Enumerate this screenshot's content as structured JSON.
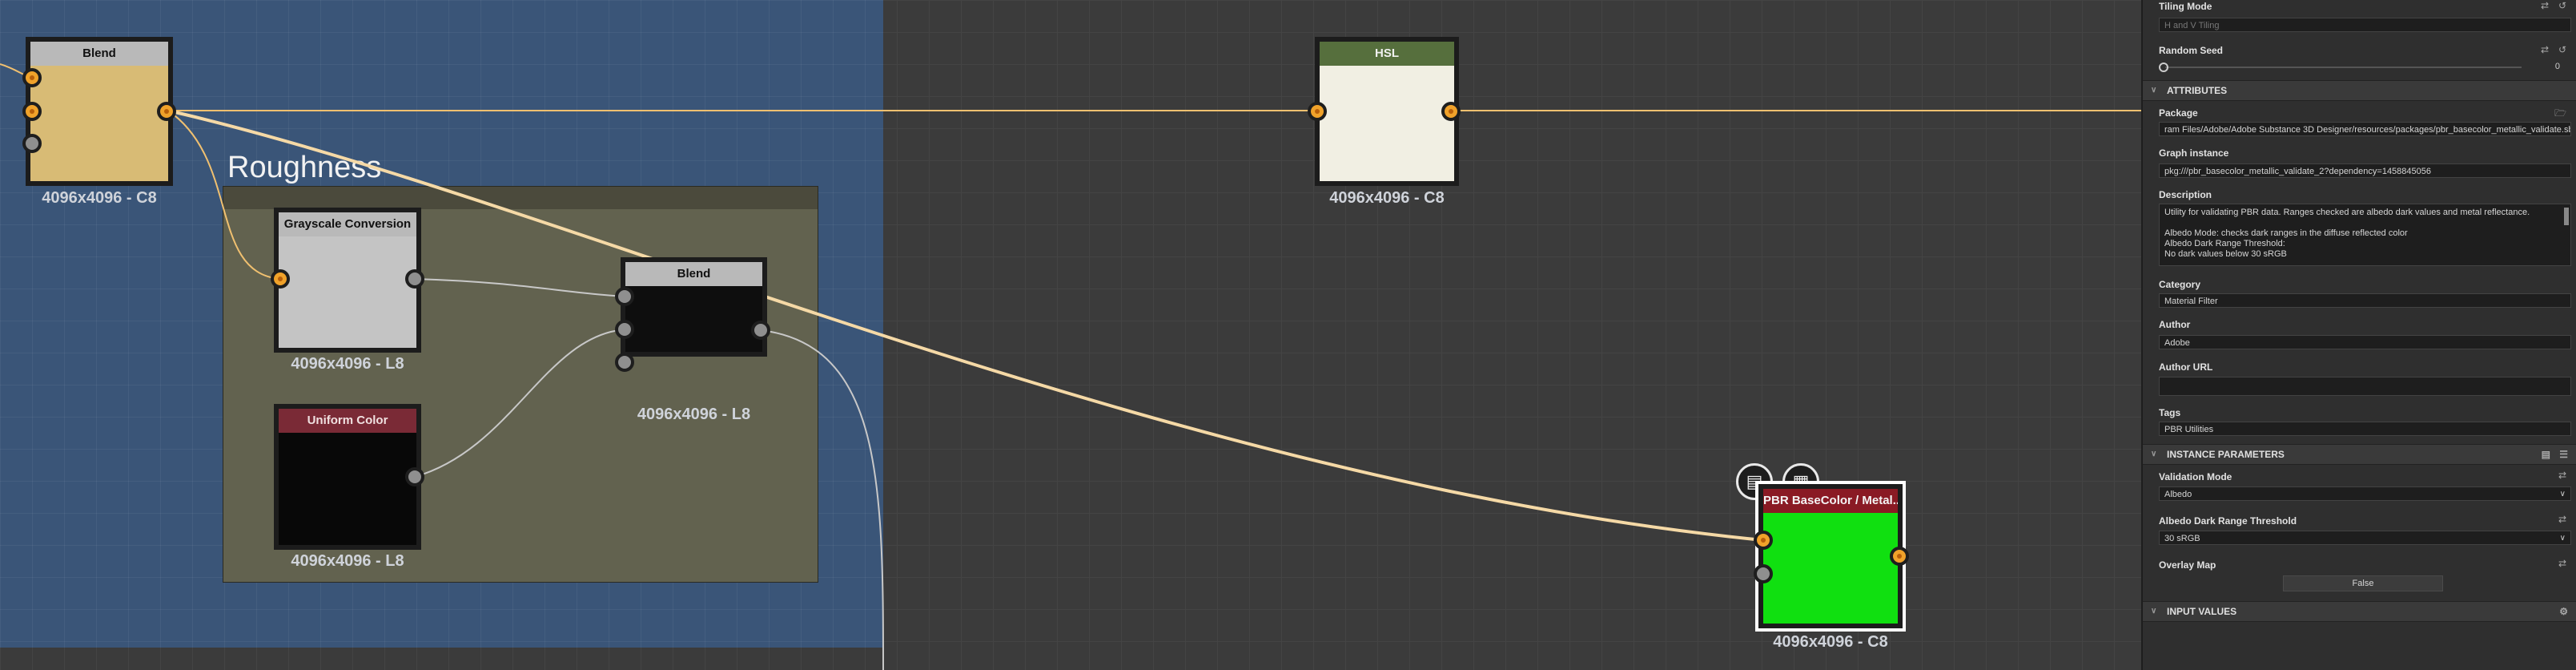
{
  "graph": {
    "frame_title": "Roughness",
    "nodes": {
      "blend_top": {
        "title": "Blend",
        "res": "4096x4096 - C8"
      },
      "grayscale": {
        "title": "Grayscale Conversion",
        "res": "4096x4096 - L8"
      },
      "blend_inner": {
        "title": "Blend",
        "res": "4096x4096 - L8"
      },
      "uniform_color": {
        "title": "Uniform Color",
        "res": "4096x4096 - L8"
      },
      "hsl": {
        "title": "HSL",
        "res": "4096x4096 - C8"
      },
      "pbr": {
        "title": "PBR BaseColor / Metal...",
        "res": "4096x4096 - C8"
      }
    },
    "icons": {
      "doc": "document-icon",
      "checker": "checker-icon"
    }
  },
  "panel": {
    "tiling_mode": {
      "label": "Tiling Mode",
      "value": "H and V Tiling"
    },
    "random_seed": {
      "label": "Random Seed",
      "value": "0"
    },
    "attributes": {
      "title": "ATTRIBUTES",
      "package_label": "Package",
      "package_value": "ram Files/Adobe/Adobe Substance 3D Designer/resources/packages/pbr_basecolor_metallic_validate.sbs",
      "graph_instance_label": "Graph instance",
      "graph_instance_value": "pkg:///pbr_basecolor_metallic_validate_2?dependency=1458845056",
      "description_label": "Description",
      "description_lines": [
        "Utility for validating PBR data. Ranges checked are albedo dark values and metal reflectance.",
        "",
        "Albedo Mode: checks dark ranges in the diffuse reflected color",
        "Albedo Dark Range Threshold:",
        "No dark values below 30 sRGB"
      ],
      "category_label": "Category",
      "category_value": "Material Filter",
      "author_label": "Author",
      "author_value": "Adobe",
      "author_url_label": "Author URL",
      "author_url_value": "",
      "tags_label": "Tags",
      "tags_value": "PBR Utilities"
    },
    "instance_params": {
      "title": "INSTANCE PARAMETERS",
      "validation_mode_label": "Validation Mode",
      "validation_mode_value": "Albedo",
      "albedo_threshold_label": "Albedo Dark Range Threshold",
      "albedo_threshold_value": "30 sRGB",
      "overlay_map_label": "Overlay Map",
      "overlay_map_value": "False"
    },
    "input_values": {
      "title": "INPUT VALUES"
    }
  },
  "colors": {
    "blend_header": "#b9b9b9",
    "hsl_header": "#566f3d",
    "uniform_header": "#7a2a36",
    "pbr_header": "#8a1a24",
    "wire_orange": "#f0c070"
  }
}
